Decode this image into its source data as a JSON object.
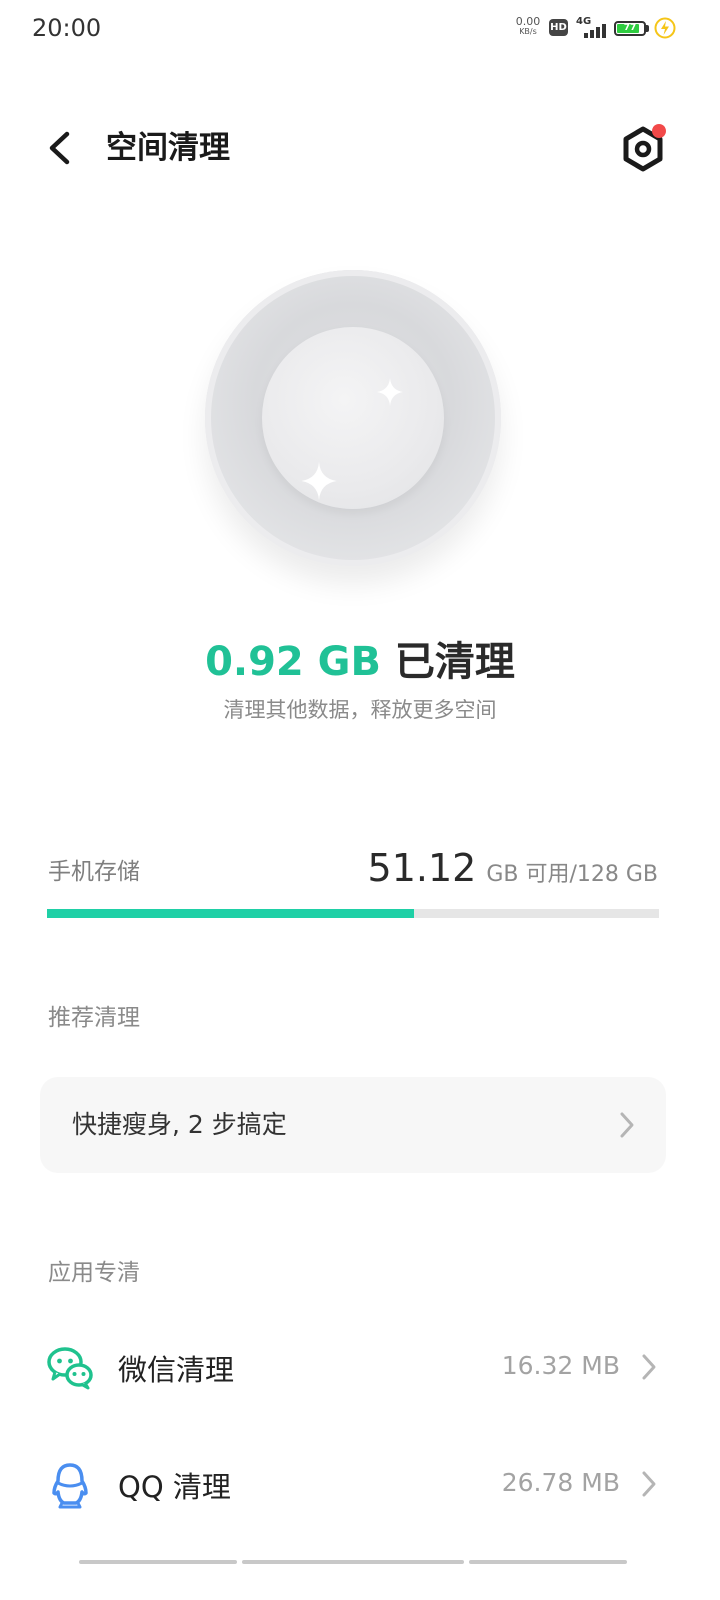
{
  "status_bar": {
    "time": "20:00",
    "net_speed_value": "0.00",
    "net_speed_unit": "KB/s",
    "hd_label": "HD",
    "network_type": "4G",
    "battery_level": "77",
    "battery_color": "#2ecc40",
    "charging_icon": "lightning-icon"
  },
  "header": {
    "title": "空间清理",
    "back_icon": "chevron-left-icon",
    "settings_icon": "gear-icon",
    "notification_dot_color": "#f24949"
  },
  "summary": {
    "cleaned_amount": "0.92 GB",
    "cleaned_label": " 已清理",
    "subtitle": "清理其他数据，释放更多空间",
    "accent_color": "#20c196"
  },
  "storage": {
    "label": "手机存储",
    "available": "51.12",
    "detail": "GB 可用/128 GB",
    "used_fraction": 0.6,
    "bar_color": "#1fd0a6"
  },
  "recommend": {
    "section_title": "推荐清理",
    "card_text": "快捷瘦身, 2 步搞定"
  },
  "apps": {
    "section_title": "应用专清",
    "items": [
      {
        "name": "微信清理",
        "size": "16.32 MB",
        "icon": "wechat-icon",
        "color": "#1fc28e"
      },
      {
        "name": "QQ 清理",
        "size": "26.78 MB",
        "icon": "qq-icon",
        "color": "#4a8ef0"
      }
    ]
  }
}
